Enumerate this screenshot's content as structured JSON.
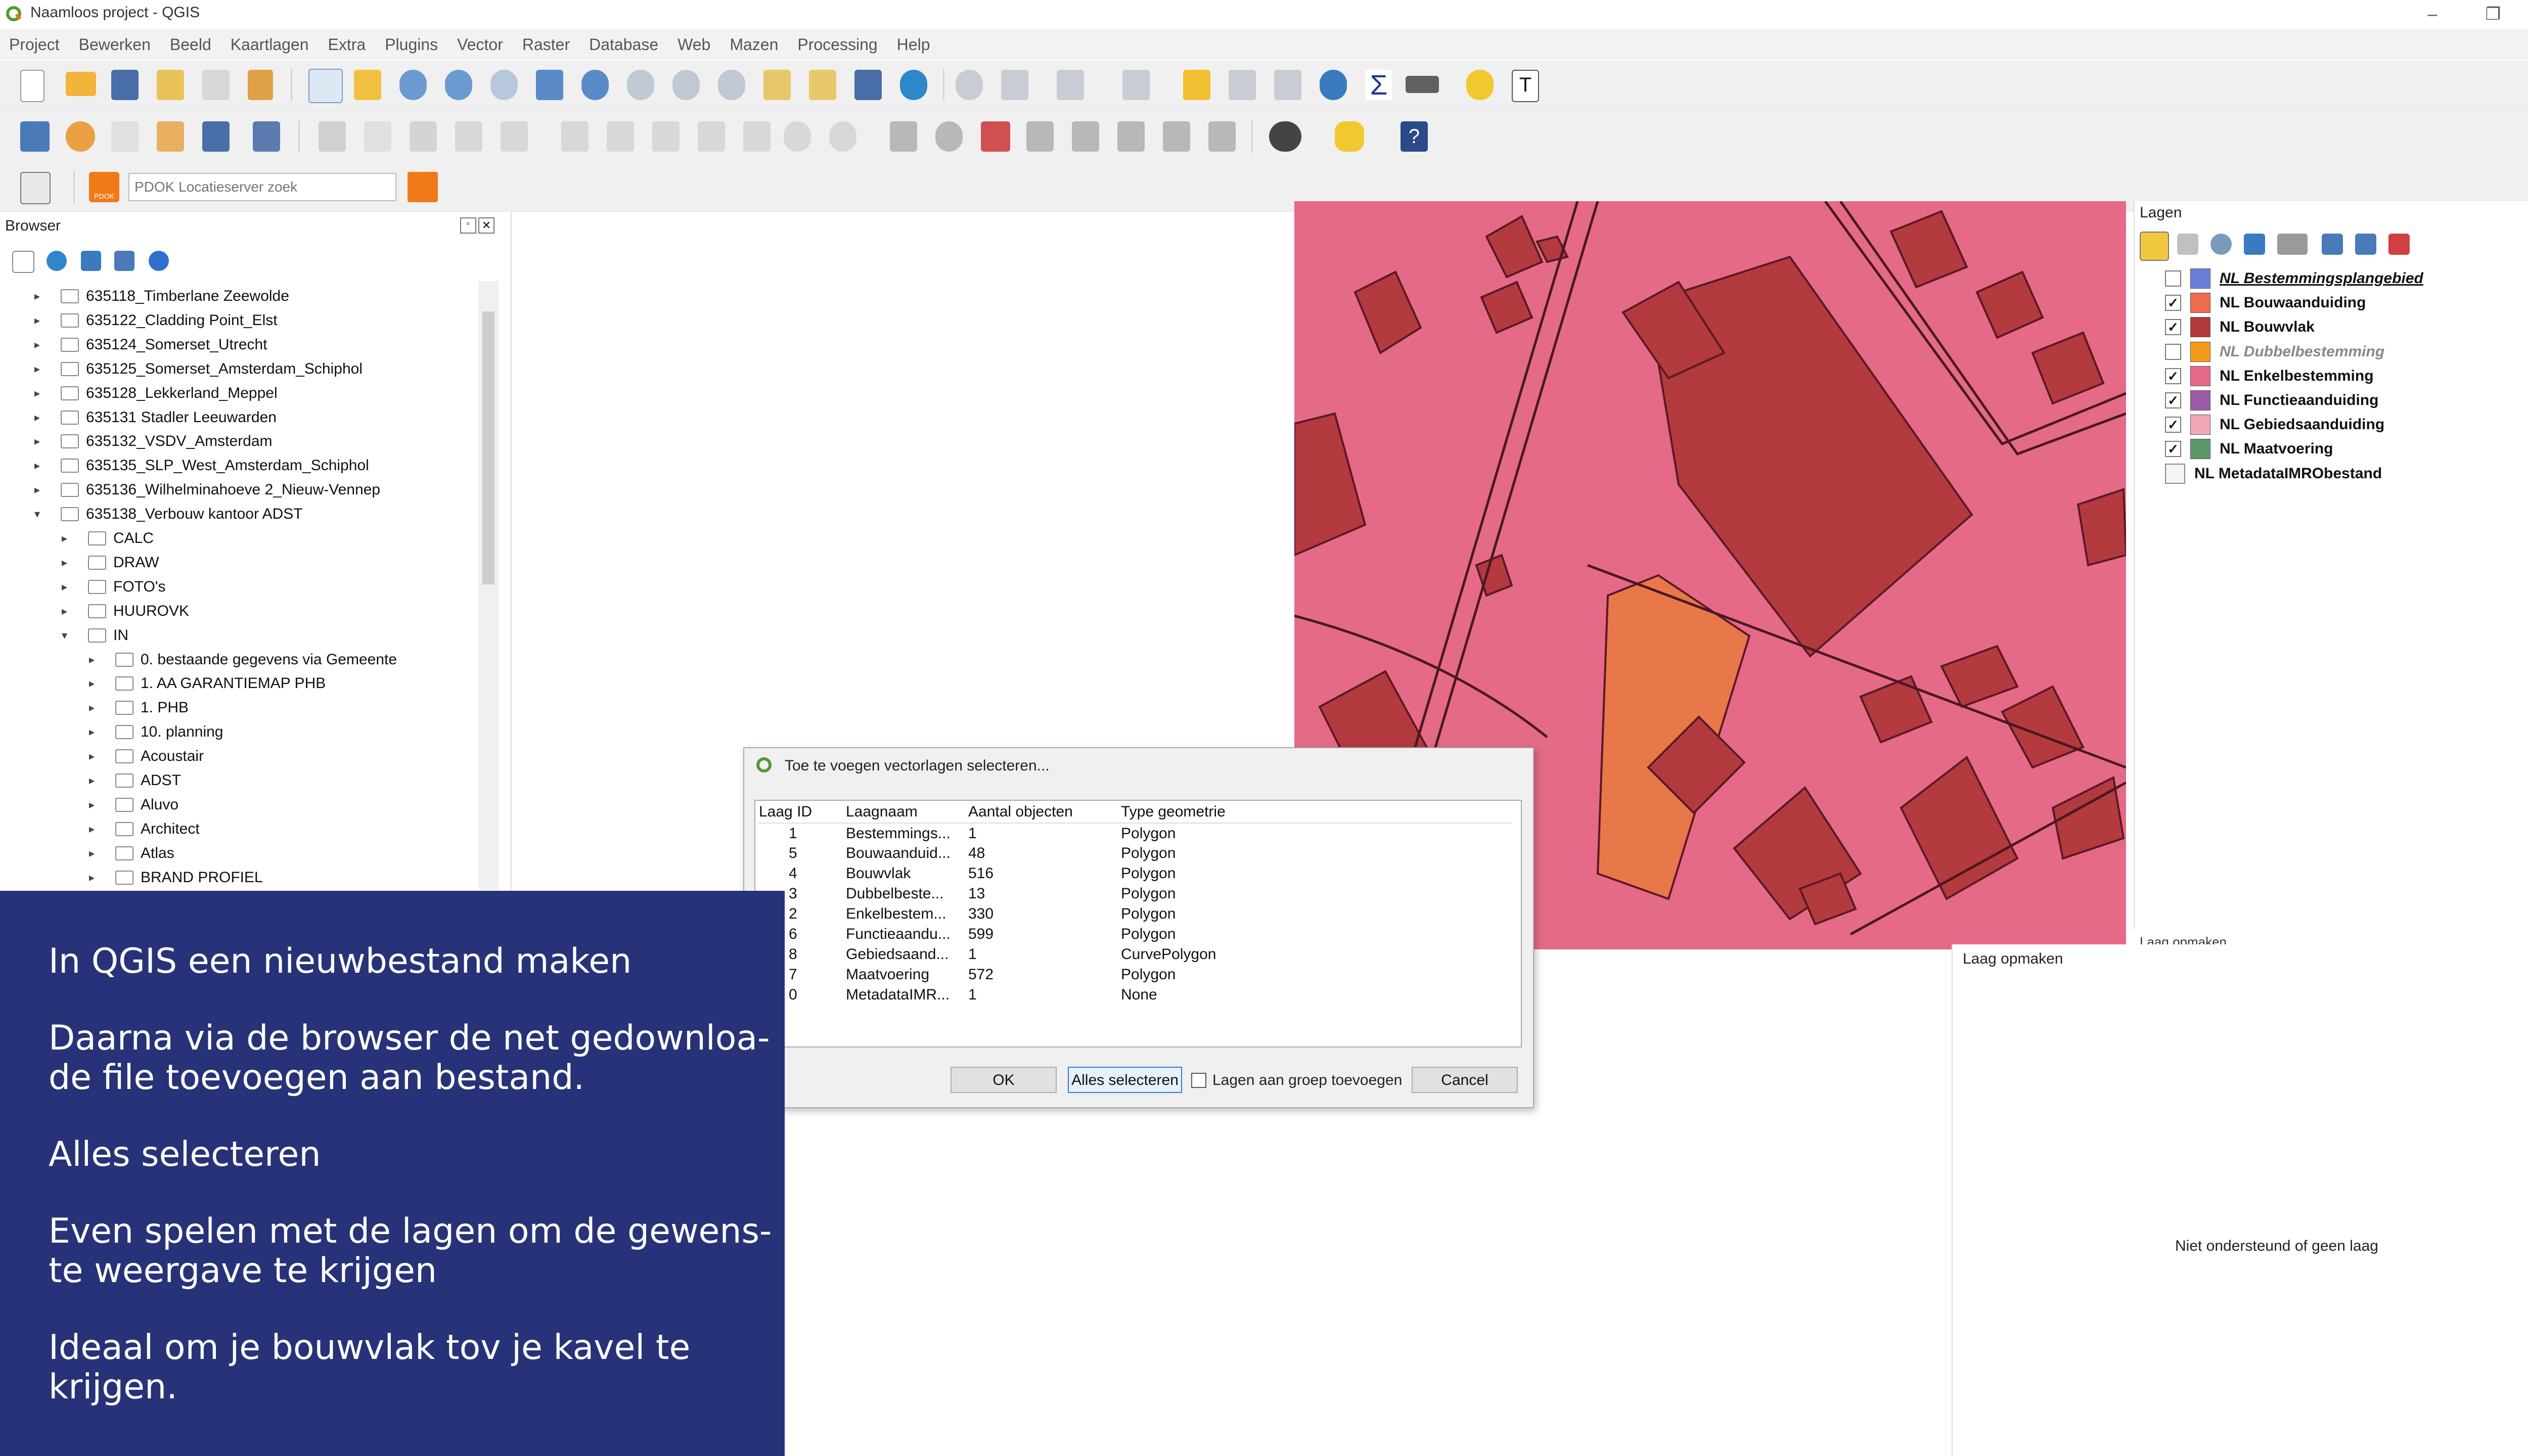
{
  "window": {
    "title": "Naamloos project - QGIS",
    "minimize": "–",
    "restore": "❐",
    "close": "✕"
  },
  "menu": [
    "Project",
    "Bewerken",
    "Beeld",
    "Kaartlagen",
    "Extra",
    "Plugins",
    "Vector",
    "Raster",
    "Database",
    "Web",
    "Mazen",
    "Processing",
    "Help"
  ],
  "locator": {
    "placeholder": "PDOK Locatieserver zoek",
    "pdok_badge": "PDOK"
  },
  "browser": {
    "title": "Browser",
    "items": [
      {
        "label": "635118_Timberlane Zeewolde",
        "depth": 0,
        "open": false
      },
      {
        "label": "635122_Cladding Point_Elst",
        "depth": 0,
        "open": false
      },
      {
        "label": "635124_Somerset_Utrecht",
        "depth": 0,
        "open": false
      },
      {
        "label": "635125_Somerset_Amsterdam_Schiphol",
        "depth": 0,
        "open": false
      },
      {
        "label": "635128_Lekkerland_Meppel",
        "depth": 0,
        "open": false
      },
      {
        "label": "635131 Stadler Leeuwarden",
        "depth": 0,
        "open": false
      },
      {
        "label": "635132_VSDV_Amsterdam",
        "depth": 0,
        "open": false
      },
      {
        "label": "635135_SLP_West_Amsterdam_Schiphol",
        "depth": 0,
        "open": false
      },
      {
        "label": "635136_Wilhelminahoeve 2_Nieuw-Vennep",
        "depth": 0,
        "open": false
      },
      {
        "label": "635138_Verbouw kantoor ADST",
        "depth": 0,
        "open": true
      },
      {
        "label": "CALC",
        "depth": 1,
        "open": false
      },
      {
        "label": "DRAW",
        "depth": 1,
        "open": false
      },
      {
        "label": "FOTO's",
        "depth": 1,
        "open": false
      },
      {
        "label": "HUUROVK",
        "depth": 1,
        "open": false
      },
      {
        "label": "IN",
        "depth": 1,
        "open": true
      },
      {
        "label": "0. bestaande gegevens via Gemeente",
        "depth": 2,
        "open": false
      },
      {
        "label": "1. AA GARANTIEMAP PHB",
        "depth": 2,
        "open": false
      },
      {
        "label": "1. PHB",
        "depth": 2,
        "open": false
      },
      {
        "label": "10. planning",
        "depth": 2,
        "open": false
      },
      {
        "label": "Acoustair",
        "depth": 2,
        "open": false
      },
      {
        "label": "ADST",
        "depth": 2,
        "open": false
      },
      {
        "label": "Aluvo",
        "depth": 2,
        "open": false
      },
      {
        "label": "Architect",
        "depth": 2,
        "open": false
      },
      {
        "label": "Atlas",
        "depth": 2,
        "open": false
      },
      {
        "label": "BRAND PROFIEL",
        "depth": 2,
        "open": false
      }
    ]
  },
  "layers": {
    "title": "Lagen",
    "items": [
      {
        "label": "NL Bestemmingsplangebied",
        "checked": false,
        "color": "#6a7fd8",
        "style": "italic-underline"
      },
      {
        "label": "NL Bouwaanduiding",
        "checked": true,
        "color": "#ef6b4f",
        "style": "bold"
      },
      {
        "label": "NL Bouwvlak",
        "checked": true,
        "color": "#b33a3a",
        "style": "bold"
      },
      {
        "label": "NL Dubbelbestemming",
        "checked": false,
        "color": "#f59a1a",
        "style": "italic-grey"
      },
      {
        "label": "NL Enkelbestemming",
        "checked": true,
        "color": "#e56a8a",
        "style": "bold"
      },
      {
        "label": "NL Functieaanduiding",
        "checked": true,
        "color": "#9b5aa6",
        "style": "bold"
      },
      {
        "label": "NL Gebiedsaanduiding",
        "checked": true,
        "color": "#f1a7b4",
        "style": "bold"
      },
      {
        "label": "NL Maatvoering",
        "checked": true,
        "color": "#5a9a6a",
        "style": "bold"
      },
      {
        "label": "NL MetadataIMRObestand",
        "checked": null,
        "color": null,
        "style": "bold"
      }
    ]
  },
  "style_panel": {
    "partial_title": "Laag opmaken",
    "title": "Laag opmaken",
    "message": "Niet ondersteund of geen laag"
  },
  "dialog": {
    "title": "Toe te voegen vectorlagen selecteren...",
    "columns": [
      "Laag ID",
      "Laagnaam",
      "Aantal objecten",
      "Type geometrie"
    ],
    "rows": [
      [
        "1",
        "Bestemmings...",
        "1",
        "Polygon"
      ],
      [
        "5",
        "Bouwaanduid...",
        "48",
        "Polygon"
      ],
      [
        "4",
        "Bouwvlak",
        "516",
        "Polygon"
      ],
      [
        "3",
        "Dubbelbeste...",
        "13",
        "Polygon"
      ],
      [
        "2",
        "Enkelbestem...",
        "330",
        "Polygon"
      ],
      [
        "6",
        "Functieaandu...",
        "599",
        "Polygon"
      ],
      [
        "8",
        "Gebiedsaand...",
        "1",
        "CurvePolygon"
      ],
      [
        "7",
        "Maatvoering",
        "572",
        "Polygon"
      ],
      [
        "0",
        "MetadataIMR...",
        "1",
        "None"
      ]
    ],
    "ok": "OK",
    "select_all": "Alles selecteren",
    "group_label": "Lagen aan groep toevoegen",
    "cancel": "Cancel"
  },
  "overlay": {
    "lines": [
      "In QGIS een nieuwbestand maken",
      "Daarna via de browser de net gedownloa-",
      "de file toevoegen aan bestand.",
      "Alles selecteren",
      "Even spelen met de lagen om de gewens-",
      "te weergave te krijgen",
      "Ideaal om je bouwvlak tov je kavel te",
      "krijgen."
    ]
  },
  "colors": {
    "overlay_bg": "#283278",
    "map_pink": "#e56a87",
    "map_dark": "#b33a3f",
    "map_orange": "#e8774a"
  }
}
